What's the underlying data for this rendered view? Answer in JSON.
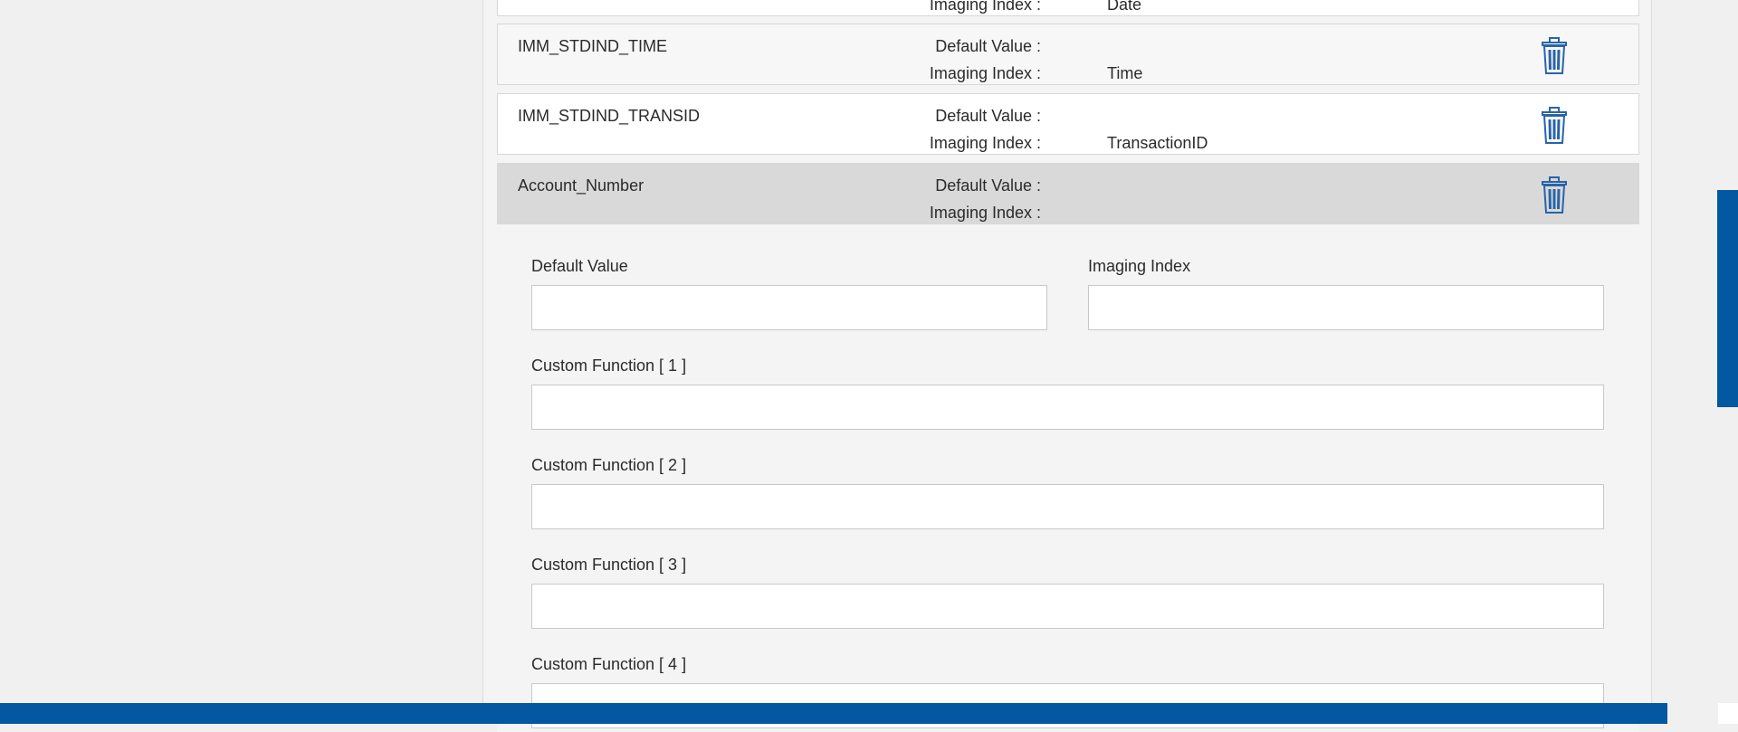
{
  "rows": [
    {
      "name": "",
      "default_label": "",
      "default_value": "",
      "index_label": "Imaging Index :",
      "index_value": "Date"
    },
    {
      "name": "IMM_STDIND_TIME",
      "default_label": "Default Value :",
      "default_value": "",
      "index_label": "Imaging Index :",
      "index_value": "Time"
    },
    {
      "name": "IMM_STDIND_TRANSID",
      "default_label": "Default Value :",
      "default_value": "",
      "index_label": "Imaging Index :",
      "index_value": "TransactionID"
    },
    {
      "name": "Account_Number",
      "default_label": "Default Value :",
      "default_value": "",
      "index_label": "Imaging Index :",
      "index_value": ""
    }
  ],
  "editor": {
    "default_value_label": "Default Value",
    "default_value": "",
    "imaging_index_label": "Imaging Index",
    "imaging_index": "",
    "custom_functions": [
      {
        "label": "Custom Function [ 1 ]",
        "value": ""
      },
      {
        "label": "Custom Function [ 2 ]",
        "value": ""
      },
      {
        "label": "Custom Function [ 3 ]",
        "value": ""
      },
      {
        "label": "Custom Function [ 4 ]",
        "value": ""
      }
    ]
  },
  "colors": {
    "accent": "#0457a1",
    "trash_icon": "#2a64a8",
    "active_row": "#d9d9d9"
  },
  "icons": {
    "delete": "trash-icon"
  }
}
